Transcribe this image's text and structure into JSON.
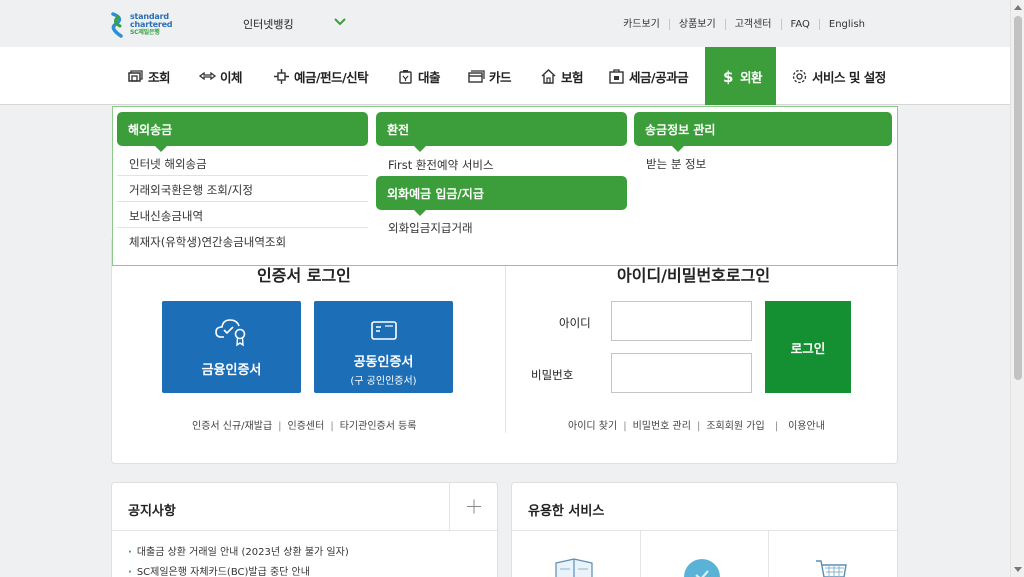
{
  "logo": {
    "line1": "standard",
    "line2": "chartered",
    "line3": "SC제일은행"
  },
  "header": {
    "banking_select": "인터넷뱅킹",
    "util_links": [
      "카드보기",
      "상품보기",
      "고객센터",
      "FAQ",
      "English"
    ]
  },
  "nav": {
    "items": [
      {
        "label": "조회",
        "icon": "inquiry-icon"
      },
      {
        "label": "이체",
        "icon": "transfer-icon"
      },
      {
        "label": "예금/펀드/신탁",
        "icon": "deposit-icon"
      },
      {
        "label": "대출",
        "icon": "loan-icon"
      },
      {
        "label": "카드",
        "icon": "card-icon"
      },
      {
        "label": "보험",
        "icon": "insurance-icon"
      },
      {
        "label": "세금/공과금",
        "icon": "tax-icon"
      },
      {
        "label": "외환",
        "icon": "dollar-icon",
        "active": true
      },
      {
        "label": "서비스 및 설정",
        "icon": "gear-icon"
      }
    ]
  },
  "dropdown": {
    "col1": {
      "title": "해외송금",
      "links": [
        "인터넷 해외송금",
        "거래외국환은행 조회/지정",
        "보내신송금내역",
        "체재자(유학생)연간송금내역조회"
      ]
    },
    "col2": {
      "title": "환전",
      "links": [
        "First 환전예약 서비스"
      ],
      "title2": "외화예금 입금/지급",
      "links2": [
        "외화입금지급거래"
      ]
    },
    "col3": {
      "title": "송금정보 관리",
      "links": [
        "받는 분 정보"
      ]
    }
  },
  "login": {
    "cert_title": "인증서 로그인",
    "id_title": "아이디/비밀번호로그인",
    "finance_cert": "금융인증서",
    "joint_cert": "공동인증서",
    "joint_cert_sub": "(구 공인인증서)",
    "cert_links": [
      "인증서 신규/재발급",
      "인증센터",
      "타기관인증서 등록"
    ],
    "id_label": "아이디",
    "pw_label": "비밀번호",
    "login_btn": "로그인",
    "id_links": [
      "아이디 찾기",
      "비밀번호 관리",
      "조회회원 가입",
      "이용안내"
    ]
  },
  "notice": {
    "title": "공지사항",
    "items": [
      "대출금 상환 거래일 안내 (2023년 상환 불가 일자)",
      "SC제일은행 자체카드(BC)발급 중단 안내"
    ]
  },
  "services": {
    "title": "유용한 서비스"
  },
  "colors": {
    "brand_green": "#3c9e3a",
    "cert_blue": "#1c6eb7",
    "login_green": "#149033"
  }
}
